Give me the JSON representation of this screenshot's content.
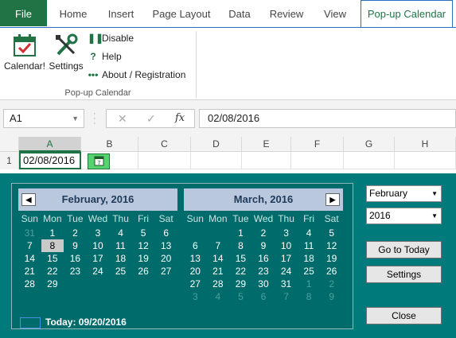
{
  "tabs": [
    "File",
    "Home",
    "Insert",
    "Page Layout",
    "Data",
    "Review",
    "View",
    "Pop-up Calendar"
  ],
  "ribbon": {
    "calendar_label": "Calendar!",
    "settings_label": "Settings",
    "disable_label": "Disable",
    "help_label": "Help",
    "about_label": "About / Registration",
    "group_label": "Pop-up Calendar"
  },
  "formula": {
    "name_box": "A1",
    "fx": "fx",
    "value": "02/08/2016"
  },
  "grid": {
    "columns": [
      "A",
      "B",
      "C",
      "D",
      "E",
      "F",
      "G",
      "H"
    ],
    "row": "1",
    "a1_value": "02/08/2016"
  },
  "calendar": {
    "dow": [
      "Sun",
      "Mon",
      "Tue",
      "Wed",
      "Thu",
      "Fri",
      "Sat"
    ],
    "left": {
      "title": "February, 2016",
      "prev_glyph": "◀",
      "weeks": [
        [
          "31",
          "1",
          "2",
          "3",
          "4",
          "5",
          "6"
        ],
        [
          "7",
          "8",
          "9",
          "10",
          "11",
          "12",
          "13"
        ],
        [
          "14",
          "15",
          "16",
          "17",
          "18",
          "19",
          "20"
        ],
        [
          "21",
          "22",
          "23",
          "24",
          "25",
          "26",
          "27"
        ],
        [
          "28",
          "29",
          "",
          "",
          "",
          "",
          ""
        ]
      ]
    },
    "right": {
      "title": "March, 2016",
      "next_glyph": "▶",
      "weeks": [
        [
          "",
          "",
          "1",
          "2",
          "3",
          "4",
          "5"
        ],
        [
          "6",
          "7",
          "8",
          "9",
          "10",
          "11",
          "12"
        ],
        [
          "13",
          "14",
          "15",
          "16",
          "17",
          "18",
          "19"
        ],
        [
          "20",
          "21",
          "22",
          "23",
          "24",
          "25",
          "26"
        ],
        [
          "27",
          "28",
          "29",
          "30",
          "31",
          "1",
          "2"
        ],
        [
          "3",
          "4",
          "5",
          "6",
          "7",
          "8",
          "9"
        ]
      ]
    },
    "today_label": "Today: 09/20/2016",
    "month_select": "February",
    "year_select": "2016",
    "goto_today": "Go to Today",
    "settings": "Settings",
    "close": "Close"
  }
}
